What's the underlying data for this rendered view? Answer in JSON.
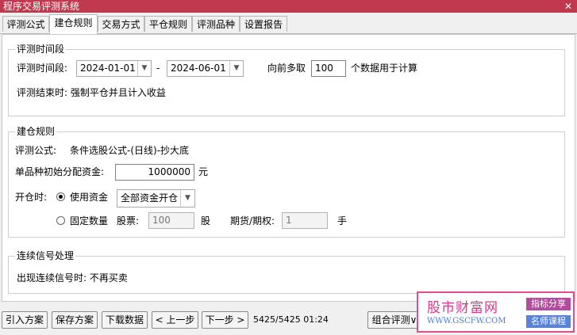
{
  "window": {
    "title": "程序交易评测系统",
    "close_glyph": "✕"
  },
  "tabs": [
    {
      "label": "评测公式"
    },
    {
      "label": "建仓规则"
    },
    {
      "label": "交易方式"
    },
    {
      "label": "平仓规则"
    },
    {
      "label": "评测品种"
    },
    {
      "label": "设置报告"
    }
  ],
  "period": {
    "legend": "评测时间段",
    "range_label": "评测时间段:",
    "start_date": "2024-01-01",
    "dash": "-",
    "end_date": "2024-06-01",
    "lookback_prefix": "向前多取",
    "lookback_value": "100",
    "lookback_suffix": "个数据用于计算",
    "end_note": "评测结束时: 强制平仓并且计入收益"
  },
  "build": {
    "legend": "建仓规则",
    "formula_label": "评测公式:",
    "formula_value": "条件选股公式-(日线)-抄大底",
    "capital_label": "单品种初始分配资金:",
    "capital_value": "1000000",
    "capital_unit": "元",
    "open_label": "开仓时:",
    "use_funds_label": "使用资金",
    "use_funds_selected": true,
    "funds_option": "全部资金开仓",
    "fixed_qty_label": "固定数量",
    "fixed_qty_selected": false,
    "stock_label": "股票:",
    "stock_value": "100",
    "stock_unit": "股",
    "futures_label": "期货/期权:",
    "futures_value": "1",
    "futures_unit": "手"
  },
  "signal": {
    "legend": "连续信号处理",
    "text": "出现连续信号时: 不再买卖"
  },
  "bottom": {
    "import_label": "引入方案",
    "save_label": "保存方案",
    "download_label": "下载数据",
    "prev_label": "< 上一步",
    "next_label": "下一步 >",
    "status": "5425/5425 01:24",
    "combo_label": "组合评测∨"
  },
  "ad": {
    "brand": "股市财富网",
    "url": "WWW.GSCFW.COM",
    "tag1": "指标分享",
    "tag2": "名师课程"
  }
}
